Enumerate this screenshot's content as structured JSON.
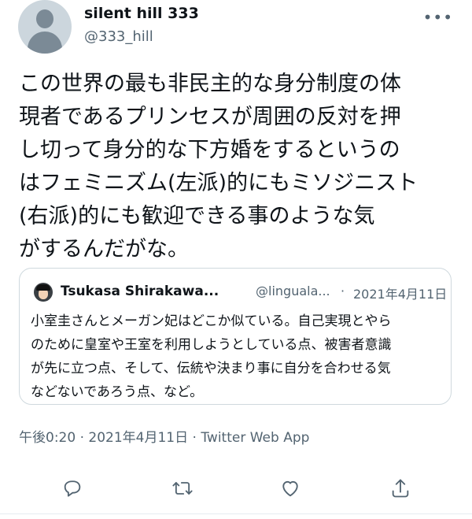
{
  "tweet": {
    "name": "silent hill 333",
    "handle": "@333_hill",
    "text": "この世界の最も非民主的な身分制度の体\n現者であるプリンセスが周囲の反対を押\nし切って身分的な下方婚をするというの\nはフェミニズム(左派)的にもミソジニスト\n(右派)的にも歓迎できる事のような気\nがするんだがな。"
  },
  "quote": {
    "name": "Tsukasa Shirakawa...",
    "handle": "@linguala...",
    "separator": "·",
    "date": "2021年4月11日",
    "text": "小室圭さんとメーガン妃はどこか似ている。自己実現とやら\nのために皇室や王室を利用しようとしている点、被害者意識\nが先に立つ点、そして、伝統や決まり事に自分を合わせる気\nなどないであろう点、など。"
  },
  "meta": {
    "time": "午後0:20",
    "sep1": "·",
    "date": "2021年4月11日",
    "sep2": "·",
    "source": "Twitter Web App"
  },
  "icons": {
    "more": "more-icon",
    "reply": "reply-icon",
    "retweet": "retweet-icon",
    "like": "heart-icon",
    "share": "share-icon"
  }
}
